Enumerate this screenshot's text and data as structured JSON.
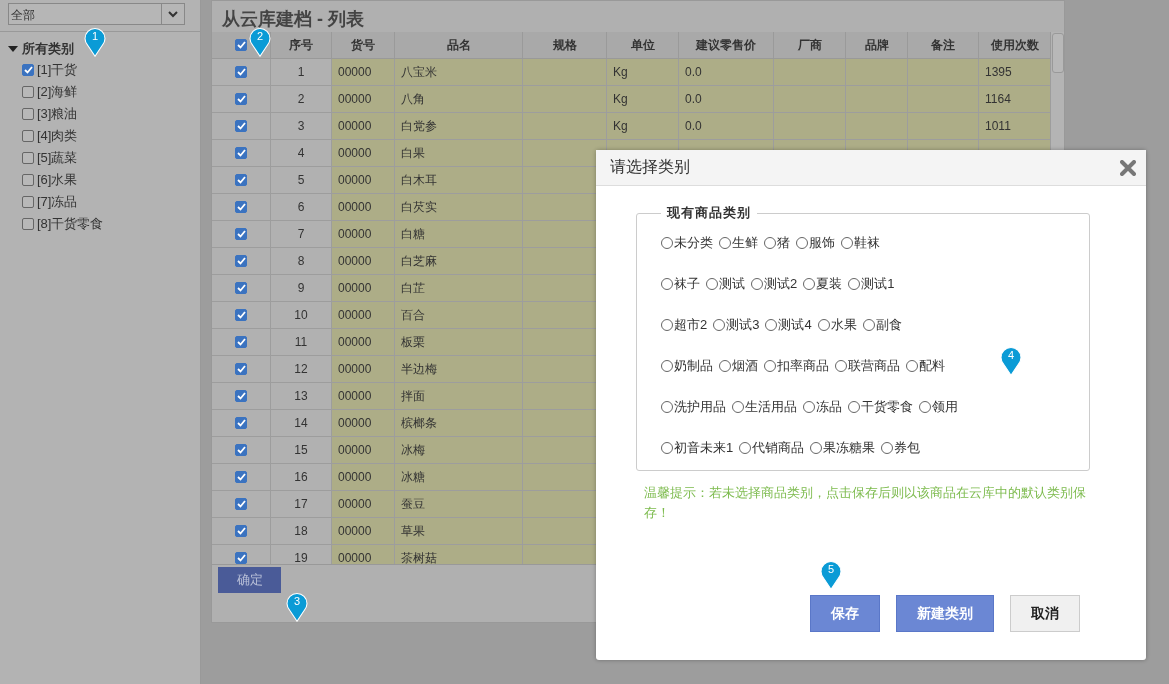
{
  "sidebar": {
    "filter": {
      "value": "全部"
    },
    "tree": {
      "label": "所有类别",
      "expanded": true,
      "children": [
        {
          "label": "[1]干货",
          "checked": true
        },
        {
          "label": "[2]海鲜",
          "checked": false
        },
        {
          "label": "[3]粮油",
          "checked": false
        },
        {
          "label": "[4]肉类",
          "checked": false
        },
        {
          "label": "[5]蔬菜",
          "checked": false
        },
        {
          "label": "[6]水果",
          "checked": false
        },
        {
          "label": "[7]冻品",
          "checked": false
        },
        {
          "label": "[8]干货零食",
          "checked": false
        }
      ]
    }
  },
  "panel": {
    "title": "从云库建档 - 列表",
    "table": {
      "all_checked": true,
      "columns": [
        "序号",
        "货号",
        "品名",
        "规格",
        "单位",
        "建议零售价",
        "厂商",
        "品牌",
        "备注",
        "使用次数"
      ],
      "rows": [
        {
          "checked": true,
          "cells": [
            "1",
            "00000",
            "八宝米",
            "",
            "Kg",
            "0.0",
            "",
            "",
            "",
            "1395"
          ]
        },
        {
          "checked": true,
          "cells": [
            "2",
            "00000",
            "八角",
            "",
            "Kg",
            "0.0",
            "",
            "",
            "",
            "1164"
          ]
        },
        {
          "checked": true,
          "cells": [
            "3",
            "00000",
            "白党参",
            "",
            "Kg",
            "0.0",
            "",
            "",
            "",
            "1011"
          ]
        },
        {
          "checked": true,
          "cells": [
            "4",
            "00000",
            "白果"
          ]
        },
        {
          "checked": true,
          "cells": [
            "5",
            "00000",
            "白木耳"
          ]
        },
        {
          "checked": true,
          "cells": [
            "6",
            "00000",
            "白芡实"
          ]
        },
        {
          "checked": true,
          "cells": [
            "7",
            "00000",
            "白糖"
          ]
        },
        {
          "checked": true,
          "cells": [
            "8",
            "00000",
            "白芝麻"
          ]
        },
        {
          "checked": true,
          "cells": [
            "9",
            "00000",
            "白芷"
          ]
        },
        {
          "checked": true,
          "cells": [
            "10",
            "00000",
            "百合"
          ]
        },
        {
          "checked": true,
          "cells": [
            "11",
            "00000",
            "板栗"
          ]
        },
        {
          "checked": true,
          "cells": [
            "12",
            "00000",
            "半边梅"
          ]
        },
        {
          "checked": true,
          "cells": [
            "13",
            "00000",
            "拌面"
          ]
        },
        {
          "checked": true,
          "cells": [
            "14",
            "00000",
            "槟榔条"
          ]
        },
        {
          "checked": true,
          "cells": [
            "15",
            "00000",
            "冰梅"
          ]
        },
        {
          "checked": true,
          "cells": [
            "16",
            "00000",
            "冰糖"
          ]
        },
        {
          "checked": true,
          "cells": [
            "17",
            "00000",
            "蚕豆"
          ]
        },
        {
          "checked": true,
          "cells": [
            "18",
            "00000",
            "草果"
          ]
        },
        {
          "checked": true,
          "cells": [
            "19",
            "00000",
            "茶树菇"
          ]
        }
      ]
    },
    "confirm_button": "确定"
  },
  "dialog": {
    "title": "请选择类别",
    "group_title": "现有商品类别",
    "category_rows": [
      [
        {
          "label": "未分类",
          "selected": false
        },
        {
          "label": "生鲜",
          "selected": false
        },
        {
          "label": "猪",
          "selected": false
        },
        {
          "label": "服饰",
          "selected": false
        },
        {
          "label": "鞋袜",
          "selected": false
        }
      ],
      [
        {
          "label": "袜子",
          "selected": false
        },
        {
          "label": "测试",
          "selected": false
        },
        {
          "label": "测试2",
          "selected": false
        },
        {
          "label": "夏装",
          "selected": false
        },
        {
          "label": "测试1",
          "selected": false
        }
      ],
      [
        {
          "label": "超市2",
          "selected": false
        },
        {
          "label": "测试3",
          "selected": false
        },
        {
          "label": "测试4",
          "selected": false
        },
        {
          "label": "水果",
          "selected": false
        },
        {
          "label": "副食",
          "selected": false
        }
      ],
      [
        {
          "label": "奶制品",
          "selected": false
        },
        {
          "label": "烟酒",
          "selected": false
        },
        {
          "label": "扣率商品",
          "selected": false
        },
        {
          "label": "联营商品",
          "selected": false
        },
        {
          "label": "配料",
          "selected": false
        }
      ],
      [
        {
          "label": "洗护用品",
          "selected": false
        },
        {
          "label": "生活用品",
          "selected": false
        },
        {
          "label": "冻品",
          "selected": false
        },
        {
          "label": "干货零食",
          "selected": false
        },
        {
          "label": "领用",
          "selected": false
        }
      ],
      [
        {
          "label": "初音未来1",
          "selected": false
        },
        {
          "label": "代销商品",
          "selected": false
        },
        {
          "label": "果冻糖果",
          "selected": false
        },
        {
          "label": "券包",
          "selected": false
        }
      ]
    ],
    "hint": "温馨提示：若未选择商品类别，点击保存后则以该商品在云库中的默认类别保存！",
    "buttons": [
      {
        "label": "保存",
        "kind": "primary"
      },
      {
        "label": "新建类别",
        "kind": "primary"
      },
      {
        "label": "取消",
        "kind": "plain"
      }
    ]
  },
  "callouts": [
    "1",
    "2",
    "3",
    "4",
    "5"
  ]
}
